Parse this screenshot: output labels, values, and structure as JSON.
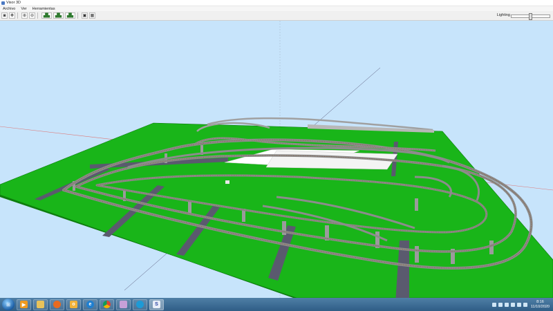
{
  "window": {
    "title": "Visor 3D"
  },
  "menu": {
    "items": [
      "Archivo",
      "Ver",
      "Herramientas"
    ]
  },
  "toolbar": {
    "buttons": [
      "camera-icon",
      "axes-icon",
      "zoom-in-icon",
      "zoom-out-icon",
      "train-icon",
      "train-icon",
      "train-icon",
      "fit-icon",
      "grid-icon"
    ],
    "lighting_label": "Lighting",
    "lighting_level": 0.5
  },
  "taskbar": {
    "apps": [
      "windows-explorer",
      "media-player",
      "file-explorer",
      "firefox",
      "outlook",
      "internet-explorer",
      "chrome",
      "paint",
      "edge",
      "app-s"
    ],
    "app_s_letter": "S",
    "clock": {
      "time": "8:16",
      "date": "11/10/2020"
    }
  },
  "colors": {
    "sky": "#c7e4fb",
    "ground": "#19b519",
    "track": "#8c8c8c",
    "road": "#5a5a6e"
  }
}
